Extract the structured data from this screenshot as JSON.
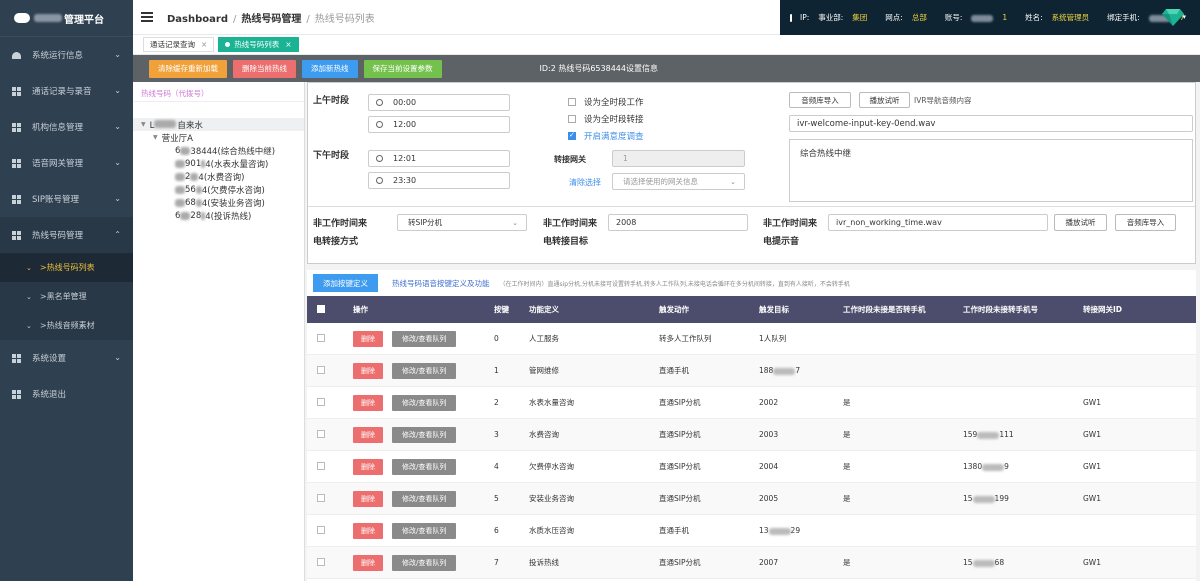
{
  "brand": {
    "title": "管理平台"
  },
  "sidebar": {
    "items": [
      {
        "label": "系统运行信息",
        "icon": "gauge-icon"
      },
      {
        "label": "通话记录与录音",
        "icon": "grid-icon"
      },
      {
        "label": "机构信息管理",
        "icon": "grid-icon"
      },
      {
        "label": "语音网关管理",
        "icon": "grid-icon"
      },
      {
        "label": "SIP账号管理",
        "icon": "grid-icon"
      },
      {
        "label": "热线号码管理",
        "icon": "grid-icon"
      }
    ],
    "subitems": [
      {
        "label": ">热线号码列表"
      },
      {
        "label": ">黑名单管理"
      },
      {
        "label": ">热线音频素材"
      }
    ],
    "bottom_items": [
      {
        "label": "系统设置"
      },
      {
        "label": "系统退出"
      }
    ]
  },
  "header": {
    "crumb1": "Dashboard",
    "crumb2": "热线号码管理",
    "crumb3": "热线号码列表",
    "ip_label": "IP:",
    "dept_label": "事业部:",
    "dept_value": "集团",
    "outlet_label": "网点:",
    "outlet_value": "总部",
    "account_label": "账号:",
    "account_suffix": "1",
    "name_label": "姓名:",
    "name_value": "系统管理员",
    "phone_label": "绑定手机:",
    "phone_suffix": "7"
  },
  "tabs": [
    {
      "label": "通话记录查询"
    },
    {
      "label": "热线号码列表"
    }
  ],
  "actions": {
    "reload": "清除缓存重新加载",
    "delete_current": "删除当前热线",
    "add": "添加新热线",
    "save": "保存当前设置参数",
    "id_text": "ID:2  热线号码6538444设置信息"
  },
  "tree": {
    "title": "热线号码（代拨号）",
    "root_suffix": "自来水",
    "branch": "营业厅A",
    "leaves": [
      {
        "prefix": "6",
        "text": "38444(综合热线中继)"
      },
      {
        "prefix": "",
        "text": "901",
        "rest": "4(水表水量咨询)"
      },
      {
        "prefix": "",
        "text": "2",
        "rest": "4(水费咨询)"
      },
      {
        "prefix": "",
        "text": "56",
        "rest": "4(欠费停水咨询)"
      },
      {
        "prefix": "",
        "text": "68",
        "rest": "4(安装业务咨询)"
      },
      {
        "prefix": "6",
        "text": "28",
        "rest": "4(投诉热线)"
      }
    ]
  },
  "settings": {
    "am_label": "上午时段",
    "am_start": "00:00",
    "am_end": "12:00",
    "pm_label": "下午时段",
    "pm_start": "12:01",
    "pm_end": "23:30",
    "chk_all_work": "设为全时段工作",
    "chk_all_transfer": "设为全时段转接",
    "chk_satisfaction": "开启满意度调查",
    "gateway_label": "转接网关",
    "gateway_value": "1",
    "clear_link": "清除选择",
    "gateway_select_placeholder": "请选择使用的网关信息",
    "audio_import": "音频库导入",
    "play_test": "播放试听",
    "ivr_desc": "IVR导航音频内容",
    "ivr_file": "ivr-welcome-input-key-0end.wav",
    "ivr_text": "综合热线中继",
    "offwork_transfer_label_1": "非工作时间来",
    "offwork_transfer_label_2": "电转接方式",
    "offwork_transfer_value": "转SIP分机",
    "offwork_target_label_1": "非工作时间来",
    "offwork_target_label_2": "电转接目标",
    "offwork_target_value": "2008",
    "offwork_prompt_label_1": "非工作时间来",
    "offwork_prompt_label_2": "电提示音",
    "offwork_prompt_value": "ivr_non_working_time.wav",
    "play_test2": "播放试听",
    "audio_import2": "音频库导入"
  },
  "keys": {
    "add_btn": "添加按键定义",
    "link": "热线号码语音按键定义及功能",
    "note": "（在工作时间内）直通sip分机,分机未接可设置转手机,转多人工作队列,未接电话会循环在多分机间转接，直到有人接听，不会转手机"
  },
  "table": {
    "headers": [
      "操作",
      "按键",
      "功能定义",
      "触发动作",
      "触发目标",
      "工作时段未接是否转手机",
      "工作时段未接转手机号",
      "转接网关ID"
    ],
    "delete_label": "删除",
    "edit_label": "修改/查看队列",
    "rows": [
      {
        "key": "0",
        "func": "人工服务",
        "action": "转多人工作队列",
        "target": "1人队列",
        "to_mobile": "",
        "mobile": "",
        "gw": ""
      },
      {
        "key": "1",
        "func": "管网维修",
        "action": "直通手机",
        "target": "188",
        "target_suffix": "7",
        "to_mobile": "",
        "mobile": "",
        "gw": ""
      },
      {
        "key": "2",
        "func": "水表水量咨询",
        "action": "直通SIP分机",
        "target": "2002",
        "to_mobile": "是",
        "mobile": "",
        "gw": "GW1"
      },
      {
        "key": "3",
        "func": "水费咨询",
        "action": "直通SIP分机",
        "target": "2003",
        "to_mobile": "是",
        "mobile": "159",
        "mobile_suffix": "111",
        "gw": "GW1"
      },
      {
        "key": "4",
        "func": "欠费停水咨询",
        "action": "直通SIP分机",
        "target": "2004",
        "to_mobile": "是",
        "mobile": "1380",
        "mobile_suffix": "9",
        "gw": "GW1"
      },
      {
        "key": "5",
        "func": "安装业务咨询",
        "action": "直通SIP分机",
        "target": "2005",
        "to_mobile": "是",
        "mobile": "15",
        "mobile_suffix": "199",
        "gw": "GW1"
      },
      {
        "key": "6",
        "func": "水质水压咨询",
        "action": "直通手机",
        "target": "13",
        "target_suffix": "29",
        "to_mobile": "",
        "mobile": "",
        "gw": ""
      },
      {
        "key": "7",
        "func": "投诉热线",
        "action": "直通SIP分机",
        "target": "2007",
        "to_mobile": "是",
        "mobile": "15",
        "mobile_suffix": "68",
        "gw": "GW1"
      }
    ]
  }
}
